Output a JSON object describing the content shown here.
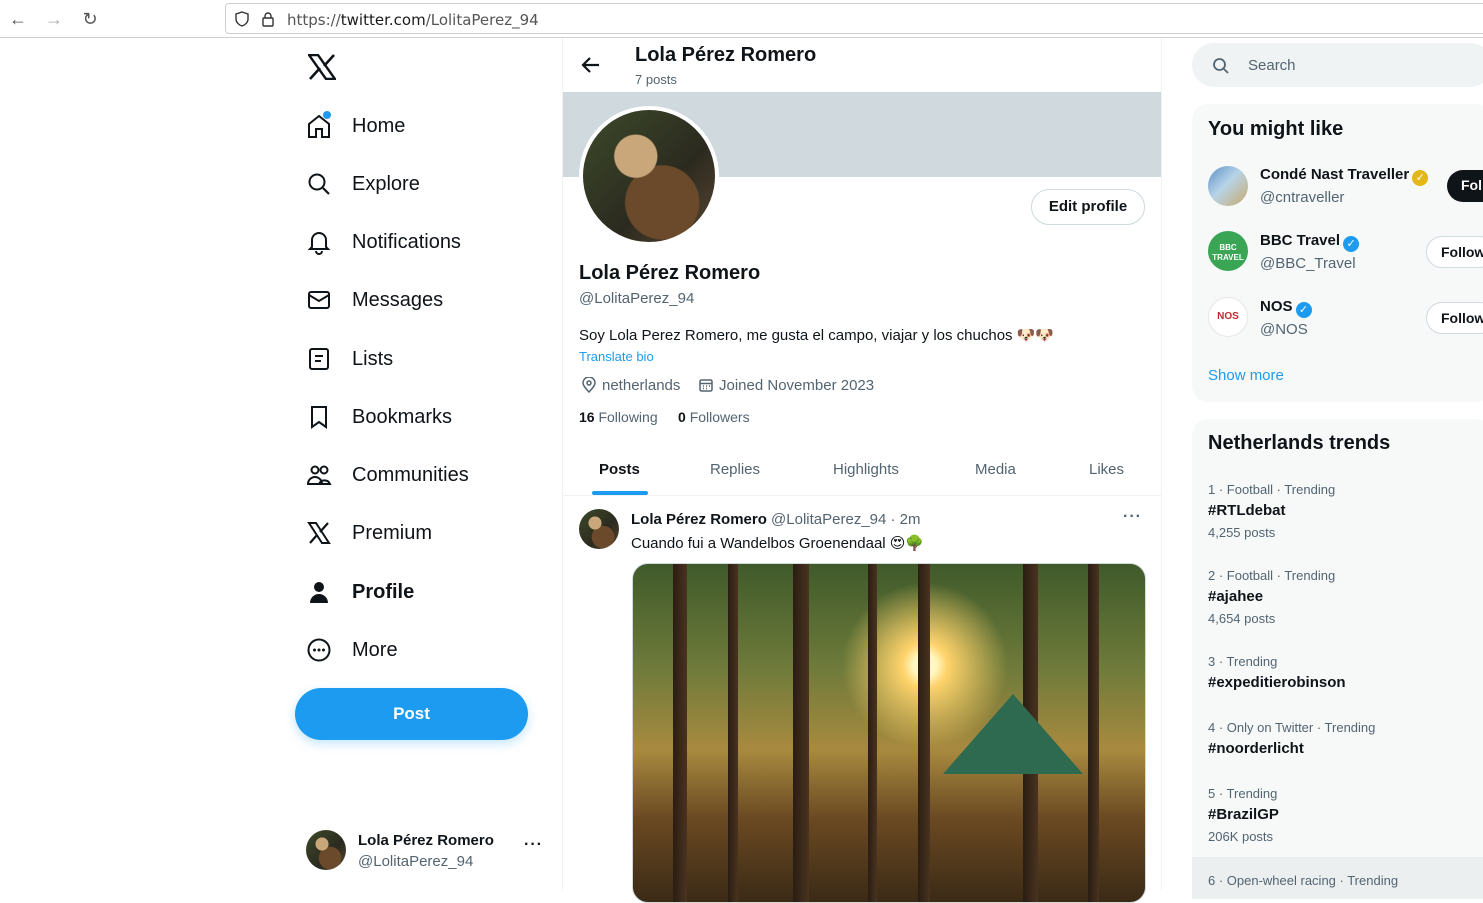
{
  "browser": {
    "url_prefix": "https://",
    "url_domain": "twitter.com",
    "url_path": "/LolitaPerez_94"
  },
  "sidebar": {
    "items": [
      {
        "label": "Home",
        "icon": "home-icon"
      },
      {
        "label": "Explore",
        "icon": "search-icon"
      },
      {
        "label": "Notifications",
        "icon": "bell-icon"
      },
      {
        "label": "Messages",
        "icon": "mail-icon"
      },
      {
        "label": "Lists",
        "icon": "list-icon"
      },
      {
        "label": "Bookmarks",
        "icon": "bookmark-icon"
      },
      {
        "label": "Communities",
        "icon": "people-icon"
      },
      {
        "label": "Premium",
        "icon": "x-logo-icon"
      },
      {
        "label": "Profile",
        "icon": "person-icon"
      },
      {
        "label": "More",
        "icon": "more-circle-icon"
      }
    ],
    "post_label": "Post",
    "account": {
      "name": "Lola Pérez Romero",
      "handle": "@LolitaPerez_94",
      "more": "···"
    }
  },
  "header": {
    "title": "Lola Pérez Romero",
    "subtitle": "7 posts"
  },
  "profile": {
    "edit_label": "Edit profile",
    "name": "Lola Pérez Romero",
    "handle": "@LolitaPerez_94",
    "bio": "Soy Lola Perez Romero, me gusta el campo, viajar y los chuchos 🐶🐶",
    "translate": "Translate bio",
    "location": "netherlands",
    "joined": "Joined November 2023",
    "following_count": "16",
    "following_label": "Following",
    "followers_count": "0",
    "followers_label": "Followers"
  },
  "tabs": [
    "Posts",
    "Replies",
    "Highlights",
    "Media",
    "Likes"
  ],
  "tweet": {
    "name": "Lola Pérez Romero",
    "meta": "@LolitaPerez_94 · 2m",
    "text": "Cuando fui a Wandelbos Groenendaal 😍🌳",
    "more": "···"
  },
  "search": {
    "placeholder": "Search"
  },
  "suggestions": {
    "title": "You might like",
    "items": [
      {
        "name": "Condé Nast Traveller",
        "handle": "@cntraveller",
        "button": "Fol",
        "verified": "gold"
      },
      {
        "name": "BBC Travel",
        "handle": "@BBC_Travel",
        "button": "Follow",
        "verified": "blue"
      },
      {
        "name": "NOS",
        "handle": "@NOS",
        "button": "Follow",
        "verified": "blue"
      }
    ],
    "show_more": "Show more"
  },
  "trends": {
    "title": "Netherlands trends",
    "items": [
      {
        "meta": "1 · Football · Trending",
        "name": "#RTLdebat",
        "count": "4,255 posts"
      },
      {
        "meta": "2 · Football · Trending",
        "name": "#ajahee",
        "count": "4,654 posts"
      },
      {
        "meta": "3 · Trending",
        "name": "#expeditierobinson",
        "count": ""
      },
      {
        "meta": "4 · Only on Twitter · Trending",
        "name": "#noorderlicht",
        "count": ""
      },
      {
        "meta": "5 · Trending",
        "name": "#BrazilGP",
        "count": "206K posts"
      },
      {
        "meta": "6 · Open-wheel racing · Trending",
        "name": "",
        "count": ""
      }
    ]
  },
  "colors": {
    "accent": "#1d9bf0",
    "banner": "#cfd9de",
    "text": "#0f1419",
    "muted": "#536471"
  }
}
